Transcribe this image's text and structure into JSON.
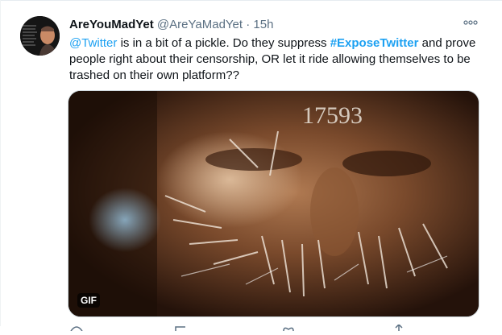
{
  "tweet": {
    "display_name": "AreYouMadYet",
    "handle": "@AreYaMadYet",
    "separator": "·",
    "time": "15h",
    "text": {
      "mention": "@Twitter",
      "part1": " is in a bit of a pickle. Do they suppress ",
      "hashtag": "#ExposeTwitter",
      "part2": " and prove people right about their censorship, OR let it ride allowing themselves to be trashed on their own platform??"
    },
    "media": {
      "badge": "GIF",
      "overlay_numbers": "17593"
    }
  },
  "colors": {
    "link": "#1da1f2",
    "secondary_text": "#5b7083",
    "primary_text": "#0f1419"
  },
  "icons": [
    "more-icon",
    "reply-icon",
    "retweet-icon",
    "like-icon",
    "share-icon"
  ]
}
